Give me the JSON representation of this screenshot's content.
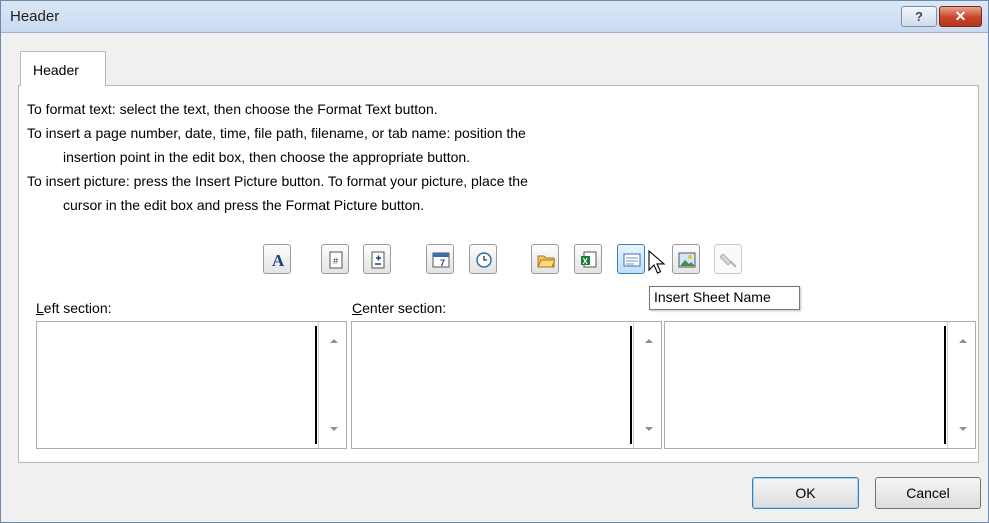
{
  "window": {
    "title": "Header"
  },
  "titlebar": {
    "help_glyph": "?",
    "close_glyph": "✕"
  },
  "tab": {
    "label": "Header"
  },
  "instructions": {
    "line1": "To format text:  select the text, then choose the Format Text button.",
    "line2": "To insert a page number, date, time, file path, filename, or tab name:  position the",
    "line3": "insertion point in the edit box, then choose the appropriate button.",
    "line4": "To insert picture: press the Insert Picture button.  To format your picture, place the",
    "line5": "cursor in the edit box and press the Format Picture button."
  },
  "toolbar": {
    "buttons": [
      {
        "icon": "format-text-icon",
        "glyph": "A"
      },
      {
        "icon": "insert-page-number-icon",
        "glyph": "#"
      },
      {
        "icon": "insert-number-of-pages-icon",
        "glyph": "+"
      },
      {
        "icon": "insert-date-icon",
        "glyph": "7"
      },
      {
        "icon": "insert-time-icon"
      },
      {
        "icon": "insert-file-path-icon"
      },
      {
        "icon": "insert-file-name-icon"
      },
      {
        "icon": "insert-sheet-name-icon",
        "state": "hover"
      },
      {
        "icon": "insert-picture-icon"
      },
      {
        "icon": "format-picture-icon",
        "state": "disabled"
      }
    ],
    "tooltip": "Insert Sheet Name"
  },
  "sections": {
    "left": {
      "accel": "L",
      "rest": "eft section:",
      "value": ""
    },
    "center": {
      "accel": "C",
      "rest": "enter section:",
      "value": ""
    },
    "right": {
      "value": ""
    }
  },
  "footer": {
    "ok": "OK",
    "cancel": "Cancel"
  }
}
